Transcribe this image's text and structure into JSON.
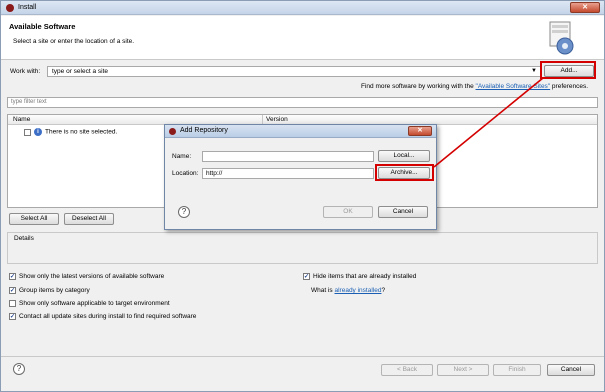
{
  "window": {
    "title": "Install",
    "close_glyph": "✕"
  },
  "header": {
    "title": "Available Software",
    "subtitle": "Select a site or enter the location of a site."
  },
  "work_with": {
    "label": "Work with:",
    "value": "type or select a site",
    "add_label": "Add...",
    "hint_prefix": "Find more software by working with the ",
    "hint_link": "\"Available Software Sites\"",
    "hint_suffix": " preferences."
  },
  "filter": {
    "placeholder": "type filter text"
  },
  "table": {
    "columns": [
      "Name",
      "Version"
    ],
    "rows": [
      {
        "name": "There is no site selected."
      }
    ]
  },
  "selection_buttons": {
    "select_all": "Select All",
    "deselect_all": "Deselect All"
  },
  "details": {
    "label": "Details"
  },
  "options": {
    "latest_versions": {
      "label": "Show only the latest versions of available software",
      "checked": true
    },
    "group_by_category": {
      "label": "Group items by category",
      "checked": true
    },
    "target_env": {
      "label": "Show only software applicable to target environment",
      "checked": false
    },
    "contact_sites": {
      "label": "Contact all update sites during install to find required software",
      "checked": true
    },
    "hide_installed": {
      "label": "Hide items that are already installed",
      "checked": true
    },
    "what_is_prefix": "What is ",
    "what_is_link": "already installed",
    "what_is_suffix": "?"
  },
  "footer": {
    "back": "< Back",
    "next": "Next >",
    "finish": "Finish",
    "cancel": "Cancel",
    "help_glyph": "?"
  },
  "dialog": {
    "title": "Add Repository",
    "close_glyph": "✕",
    "name_label": "Name:",
    "name_value": "",
    "local_label": "Local...",
    "location_label": "Location:",
    "location_value": "http://",
    "archive_label": "Archive...",
    "ok_label": "OK",
    "cancel_label": "Cancel",
    "help_glyph": "?"
  },
  "colors": {
    "highlight": "#d40000",
    "link": "#1a5fb4"
  }
}
